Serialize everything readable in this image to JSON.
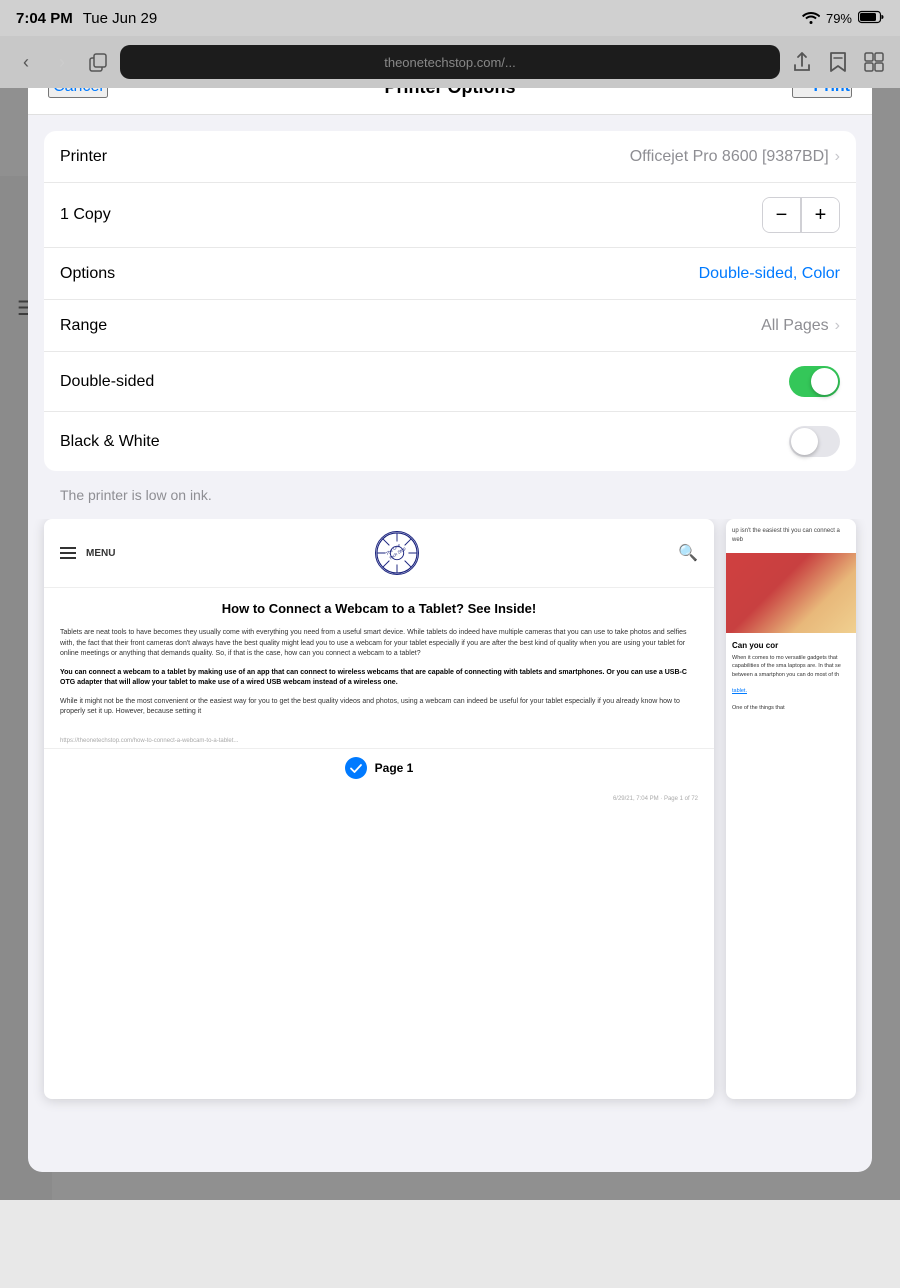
{
  "statusBar": {
    "time": "7:04 PM",
    "date": "Tue Jun 29",
    "battery": "79%",
    "wifi": "WiFi"
  },
  "modal": {
    "title": "Printer Options",
    "cancelLabel": "Cancel",
    "printLabel": "Print"
  },
  "printerOptions": {
    "printerLabel": "Printer",
    "printerValue": "Officejet Pro 8600 [9387BD]",
    "copyLabel": "1 Copy",
    "copyCount": "1",
    "optionsLabel": "Options",
    "optionsValue": "Double-sided, Color",
    "rangeLabel": "Range",
    "rangeValue": "All Pages",
    "doubleSidedLabel": "Double-sided",
    "doubleSidedEnabled": true,
    "blackWhiteLabel": "Black & White",
    "blackWhiteEnabled": false,
    "warningText": "The printer is low on ink.",
    "minusLabel": "−",
    "plusLabel": "+"
  },
  "preview": {
    "menuLabel": "MENU",
    "logoText": "The One Tech Stop",
    "articleTitle": "How to Connect a Webcam to a Tablet? See Inside!",
    "articlePara1": "Tablets are neat tools to have becomes they usually come with everything you need from a useful smart device. While tablets do indeed have multiple cameras that you can use to take photos and selfies with, the fact that their front cameras don't always have the best quality might lead you to use a webcam for your tablet especially if you are after the best kind of quality when you are using your tablet for online meetings or anything that demands quality. So, if that is the case, how can you connect a webcam to a tablet?",
    "articlePara2Bold": "You can connect a webcam to a tablet by making use of an app that can connect to wireless webcams that are capable of connecting with tablets and smartphones. Or you can use a USB-C OTG adapter that will allow your tablet to make use of a wired USB webcam instead of a wireless one.",
    "articlePara3": "While it might not be the most convenient or the easiest way for you to get the best quality videos and photos, using a webcam can indeed be useful for your tablet especially if you already know how to properly set it up. However, because setting it",
    "pageLabel": "Page 1",
    "footerUrl": "https://theonetechstop.com/how-to-connect-a-webcam-to-...",
    "secondaryText1": "up isn't the easiest thi you can connect a web",
    "secondaryHeading": "Can you cor",
    "secondaryBody1": "When it comes to mo versatile gadgets that capabilities of the sma laptops are. In that se between a smartphon you can do most of th",
    "secondaryLink": "tablet.",
    "secondaryBody2": "One of the things that"
  },
  "icons": {
    "back": "‹",
    "forward": "›",
    "tabs": "⊞",
    "share": "↑",
    "bookmark": "⬇",
    "sidebar": "☰",
    "search": "⌕",
    "wifi": "▲",
    "battery": "▐"
  }
}
